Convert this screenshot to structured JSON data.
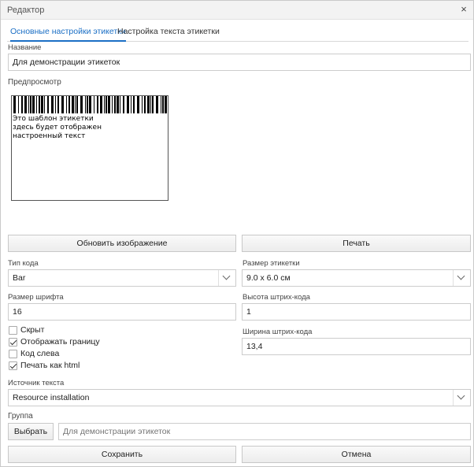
{
  "window": {
    "title": "Редактор",
    "close_glyph": "×"
  },
  "tabs": [
    {
      "label": "Основные настройки этикетки",
      "active": true
    },
    {
      "label": "Настройка текста этикетки",
      "active": false
    }
  ],
  "name": {
    "label": "Название",
    "value": "Для демонстрации этикеток"
  },
  "preview": {
    "label": "Предпросмотр",
    "text": "Это шаблон этикетки\nздесь будет отображен\nнастроенный текст"
  },
  "actions": {
    "refresh_label": "Обновить изображение",
    "print_label": "Печать"
  },
  "code_type": {
    "label": "Тип кода",
    "value": "Bar"
  },
  "label_size": {
    "label": "Размер этикетки",
    "value": "9.0 x 6.0 см"
  },
  "font_size": {
    "label": "Размер шрифта",
    "value": "16"
  },
  "barcode_height": {
    "label": "Высота штрих-кода",
    "value": "1"
  },
  "barcode_width": {
    "label": "Ширина штрих-кода",
    "value": "13,4"
  },
  "options": [
    {
      "label": "Скрыт",
      "checked": false
    },
    {
      "label": "Отображать границу",
      "checked": true
    },
    {
      "label": "Код слева",
      "checked": false
    },
    {
      "label": "Печать как html",
      "checked": true
    }
  ],
  "text_source": {
    "label": "Источник текста",
    "value": "Resource installation"
  },
  "group": {
    "label": "Группа",
    "select_label": "Выбрать",
    "placeholder": "Для демонстрации этикеток"
  },
  "footer": {
    "save_label": "Сохранить",
    "cancel_label": "Отмена"
  },
  "colors": {
    "accent": "#1b6fc5",
    "border": "#cccccc"
  }
}
